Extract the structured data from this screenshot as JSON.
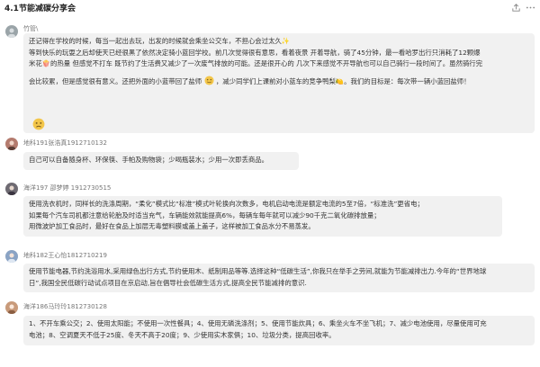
{
  "header": {
    "title": "4.1节能减碳分享会",
    "share_icon": "share-icon",
    "more_icon": "more-icon"
  },
  "messages": [
    {
      "author": "竹管\\",
      "avatar": "user-avatar",
      "lines": [
        "还记得在学校的时候，每当一起出去玩，出发的时候就会乘坐公交车，不担心会过太久✨",
        "等到快乐的玩耍之后却使天已经很黑了依然决定骑小蓝回学校。前几次觉得很有意思，看着夜景 开着导航，骑了45分钟，最一看哈罗出行只消耗了12颗爆",
        "米花🍿的热量 但感觉不打车 既节约了生活费又减少了一次废气排放的可能。还是很开心的 几次下来感觉不开导航也可以自己骑行一段时间了。虽然骑行完",
        "会比较累，但是感觉很有意义。还把外面的小蓝带回了盐师",
        "，减少同学们上课前对小蓝车的竞争鸭梨🍋。我们的目标是：每次带一辆小蓝回盐师！"
      ]
    },
    {
      "author": "地科191张浩真1912710132",
      "avatar": "user-avatar",
      "lines": [
        "自己可以自备随身杯、环保筷、手帕及购物袋；少喝瓶装水；少用一次即丢商品。"
      ]
    },
    {
      "author": "海洋197 邵梦婷 1912730515",
      "avatar": "user-avatar",
      "lines": [
        "使用洗衣机时，同样长的洗涤周期，“柔化”模式比“标准”模式叶轮换向次数多，电机启动电流是额定电流的5至7倍，“标准洗”更省电；",
        "如果每个汽车司机都注意给轮胎及时适当充气，车辆能效就能提高6%，每辆车每年就可以减少90千克二氧化碳排放量；",
        "用微波炉加工食品时，最好在食品上加层无毒塑料膜或盖上盖子，这样被加工食品水分不易蒸发。"
      ]
    },
    {
      "author": "地科182王心怡1812710219",
      "avatar": "user-avatar",
      "lines": [
        "使用节能电器,节约洗浴用水,采用绿色出行方式,节约使用木、纸制用品等等.选择这种“低碳生活”,你我只在举手之劳间,就能为节能减排出力.今年的“世界地球",
        "日”,我国全民低碳行动试点项目在京启动,旨在倡导社会低碳生活方式,提高全民节能减排的意识."
      ]
    },
    {
      "author": "海洋186马玲玲1812730128",
      "avatar": "user-avatar",
      "lines": [
        "1、不开车乘公交；2、使用太阳能；不使用一次性餐具；4、使用无磷洗涤剂；5、使用节能炊具；6、乘坐火车不坐飞机；7、减少电池使用，尽量使用可充",
        "电池；8、空调夏天不低于25度、冬天不高于20度；9、少使用实木家俱；10、垃圾分类，提高回收率。"
      ]
    }
  ]
}
